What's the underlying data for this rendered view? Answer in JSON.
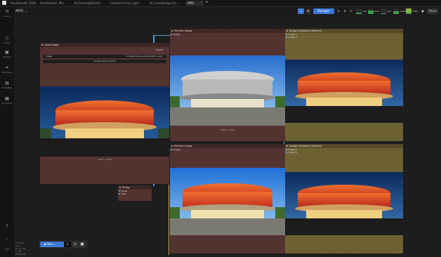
{
  "tabs": [
    {
      "label": "FaceDetailer_SDXL",
      "active": false
    },
    {
      "label": "FaceDetailer_Mix",
      "active": false
    },
    {
      "label": "18_FluxImgToGGUF",
      "active": false
    },
    {
      "label": "ComfyUI_fresp_night",
      "active": false
    },
    {
      "label": "01_FluxStorage_flu...",
      "active": false
    },
    {
      "label": "APIS",
      "active": true
    }
  ],
  "workspace": {
    "name": "APIS"
  },
  "toolbar": {
    "manager_label": "Manager",
    "meters": [
      {
        "label": "CPU",
        "value": 0.2
      },
      {
        "label": "RAM",
        "value": 0.6
      },
      {
        "label": "GPU",
        "value": 0.1
      },
      {
        "label": "VRAM",
        "value": 0.5
      },
      {
        "label": "TEMP",
        "value": 0.3
      }
    ],
    "share_label": "Share"
  },
  "sidebar": {
    "items": [
      {
        "label": "Queue",
        "icon": "history-icon"
      },
      {
        "label": "Nodes",
        "icon": "nodes-icon"
      },
      {
        "label": "Models",
        "icon": "cube-icon"
      },
      {
        "label": "Workflows",
        "icon": "workflow-icon"
      },
      {
        "label": "NodeMap",
        "icon": "map-icon"
      },
      {
        "label": "Templates",
        "icon": "template-icon"
      }
    ],
    "bottom": [
      "help-icon",
      "console-icon",
      "keyboard-icon"
    ]
  },
  "nodes": {
    "load_image": {
      "title": "Load Image",
      "id_badge": "#1234",
      "file": "ComfyUI_temp_vyrjm_00001_.png",
      "upload_label": "choose file to upload",
      "size_label": "1024 × 1024"
    },
    "preview_1": {
      "title": "Preview Image",
      "slot": "images",
      "size_label": "1024 × 1024"
    },
    "compare_1": {
      "title": "Image Comparer (rgthree)",
      "slots": [
        "image_a",
        "image_b"
      ]
    },
    "preview_2": {
      "title": "Preview Image",
      "slot": "images"
    },
    "compare_2": {
      "title": "Image Comparer (rgthree)",
      "slots": [
        "image_a",
        "image_b"
      ]
    },
    "rmbg": {
      "title": "Rmbg",
      "slots": [
        "image",
        "mask"
      ]
    }
  },
  "queue": {
    "label": "Run",
    "count": "1"
  },
  "stats": [
    "T: 0.00s",
    "I: 0",
    "N: 17 [17]",
    "V: 28",
    "FPS:60.00"
  ],
  "colors": {
    "accent": "#3b78d8",
    "node_red": "#533330",
    "node_olive": "#6d6133",
    "wire": "#4aa0c8"
  }
}
